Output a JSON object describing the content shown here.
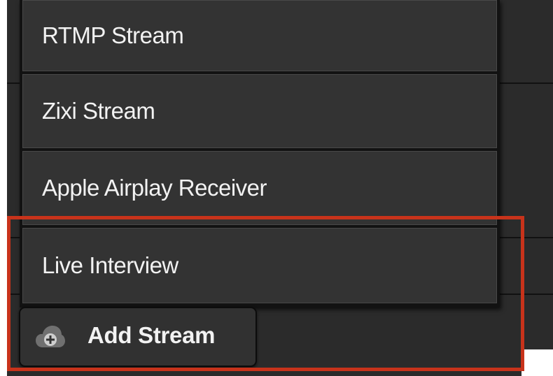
{
  "stream_menu": {
    "items": [
      {
        "label": "RTMP Stream"
      },
      {
        "label": "Zixi Stream"
      },
      {
        "label": "Apple Airplay Receiver"
      },
      {
        "label": "Live Interview"
      }
    ],
    "add_button": {
      "label": "Add Stream",
      "icon": "cloud-plus-icon"
    }
  },
  "highlight": {
    "color": "#c8331b"
  },
  "colors": {
    "menu_item_bg": "#333333",
    "text": "#f2f2f2"
  }
}
